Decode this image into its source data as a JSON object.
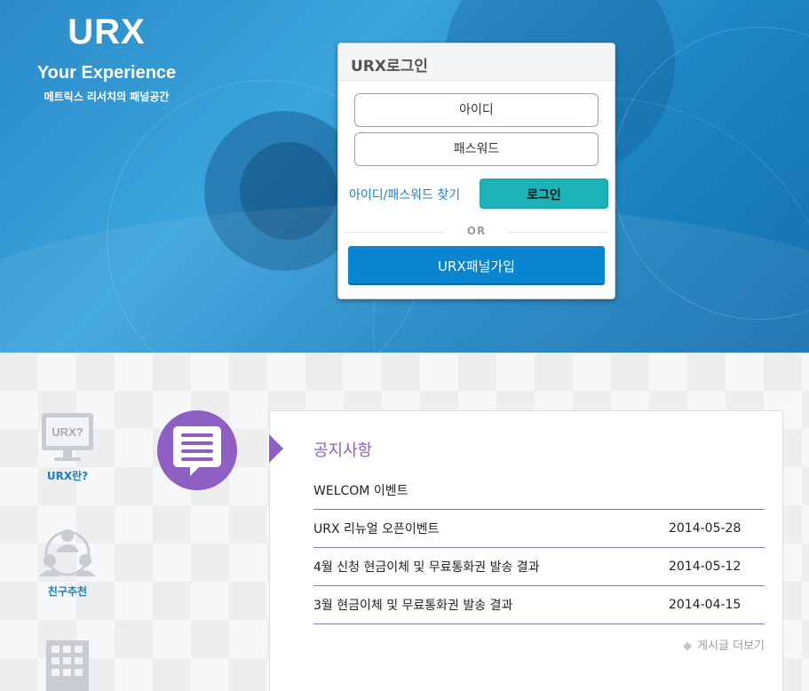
{
  "brand": {
    "logo": "URX",
    "tagline": "Your Experience",
    "subtitle": "메트릭스 리서치의 패널공간"
  },
  "login": {
    "title": "URX로그인",
    "id_placeholder": "아이디",
    "password_placeholder": "패스워드",
    "find_link": "아이디/패스워드 찾기",
    "login_button": "로그인",
    "or_text": "OR",
    "join_button": "URX패널가입"
  },
  "sidebar": {
    "items": [
      {
        "label": "URX란?",
        "icon": "monitor-icon",
        "icon_text": "URX?"
      },
      {
        "label": "친구추천",
        "icon": "people-icon"
      },
      {
        "label": "",
        "icon": "building-icon"
      }
    ]
  },
  "notice": {
    "title": "공지사항",
    "featured": "WELCOM 이벤트",
    "items": [
      {
        "title": "URX 리뉴얼 오픈이벤트",
        "date": "2014-05-28"
      },
      {
        "title": "4월 신청 현금이체 및 무료통화권 발송 결과",
        "date": "2014-05-12"
      },
      {
        "title": "3월 현금이체 및 무료통화권 발송 결과",
        "date": "2014-04-15"
      }
    ],
    "more_label": "게시글 더보기"
  },
  "colors": {
    "hero_blue": "#2a8ac8",
    "login_teal": "#1bb3b7",
    "join_blue": "#0a86d1",
    "notice_purple": "#8f5fc4",
    "side_label_blue": "#1a7dbf"
  }
}
